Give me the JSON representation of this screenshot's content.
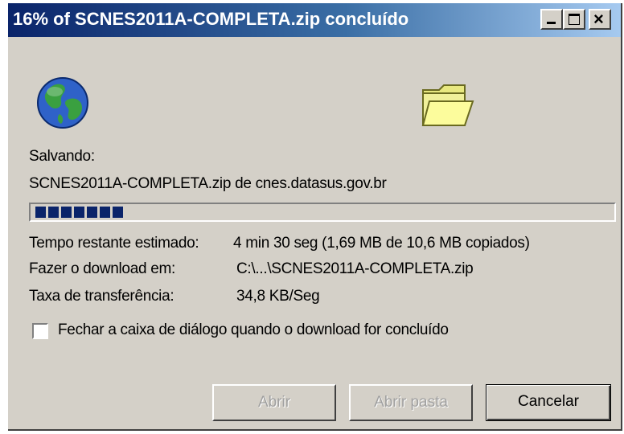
{
  "window": {
    "title": "16% of SCNES2011A-COMPLETA.zip concluído",
    "controls": {
      "minimize": "_",
      "maximize": "□",
      "close": "×"
    }
  },
  "icons": {
    "source": "globe-icon",
    "destination": "folder-icon"
  },
  "download": {
    "saving_label": "Salvando:",
    "file_and_source": "SCNES2011A-COMPLETA.zip de cnes.datasus.gov.br",
    "progress_fraction": 0.16,
    "time_left_label": "Tempo restante estimado:",
    "time_left_value": "4 min 30 seg (1,69 MB de 10,6 MB copiados)",
    "download_to_label": "Fazer o download em:",
    "download_to_value": "C:\\...\\SCNES2011A-COMPLETA.zip",
    "transfer_rate_label": "Taxa de transferência:",
    "transfer_rate_value": "34,8 KB/Seg"
  },
  "options": {
    "close_when_done_label": "Fechar a caixa de diálogo quando o download for concluído",
    "close_when_done_checked": false
  },
  "buttons": {
    "open": "Abrir",
    "open_folder": "Abrir pasta",
    "cancel": "Cancelar"
  },
  "colors": {
    "titlebar_start": "#0a246a",
    "titlebar_end": "#a6caf0",
    "dialog_face": "#d4d0c8",
    "progress_block": "#0a246a"
  }
}
